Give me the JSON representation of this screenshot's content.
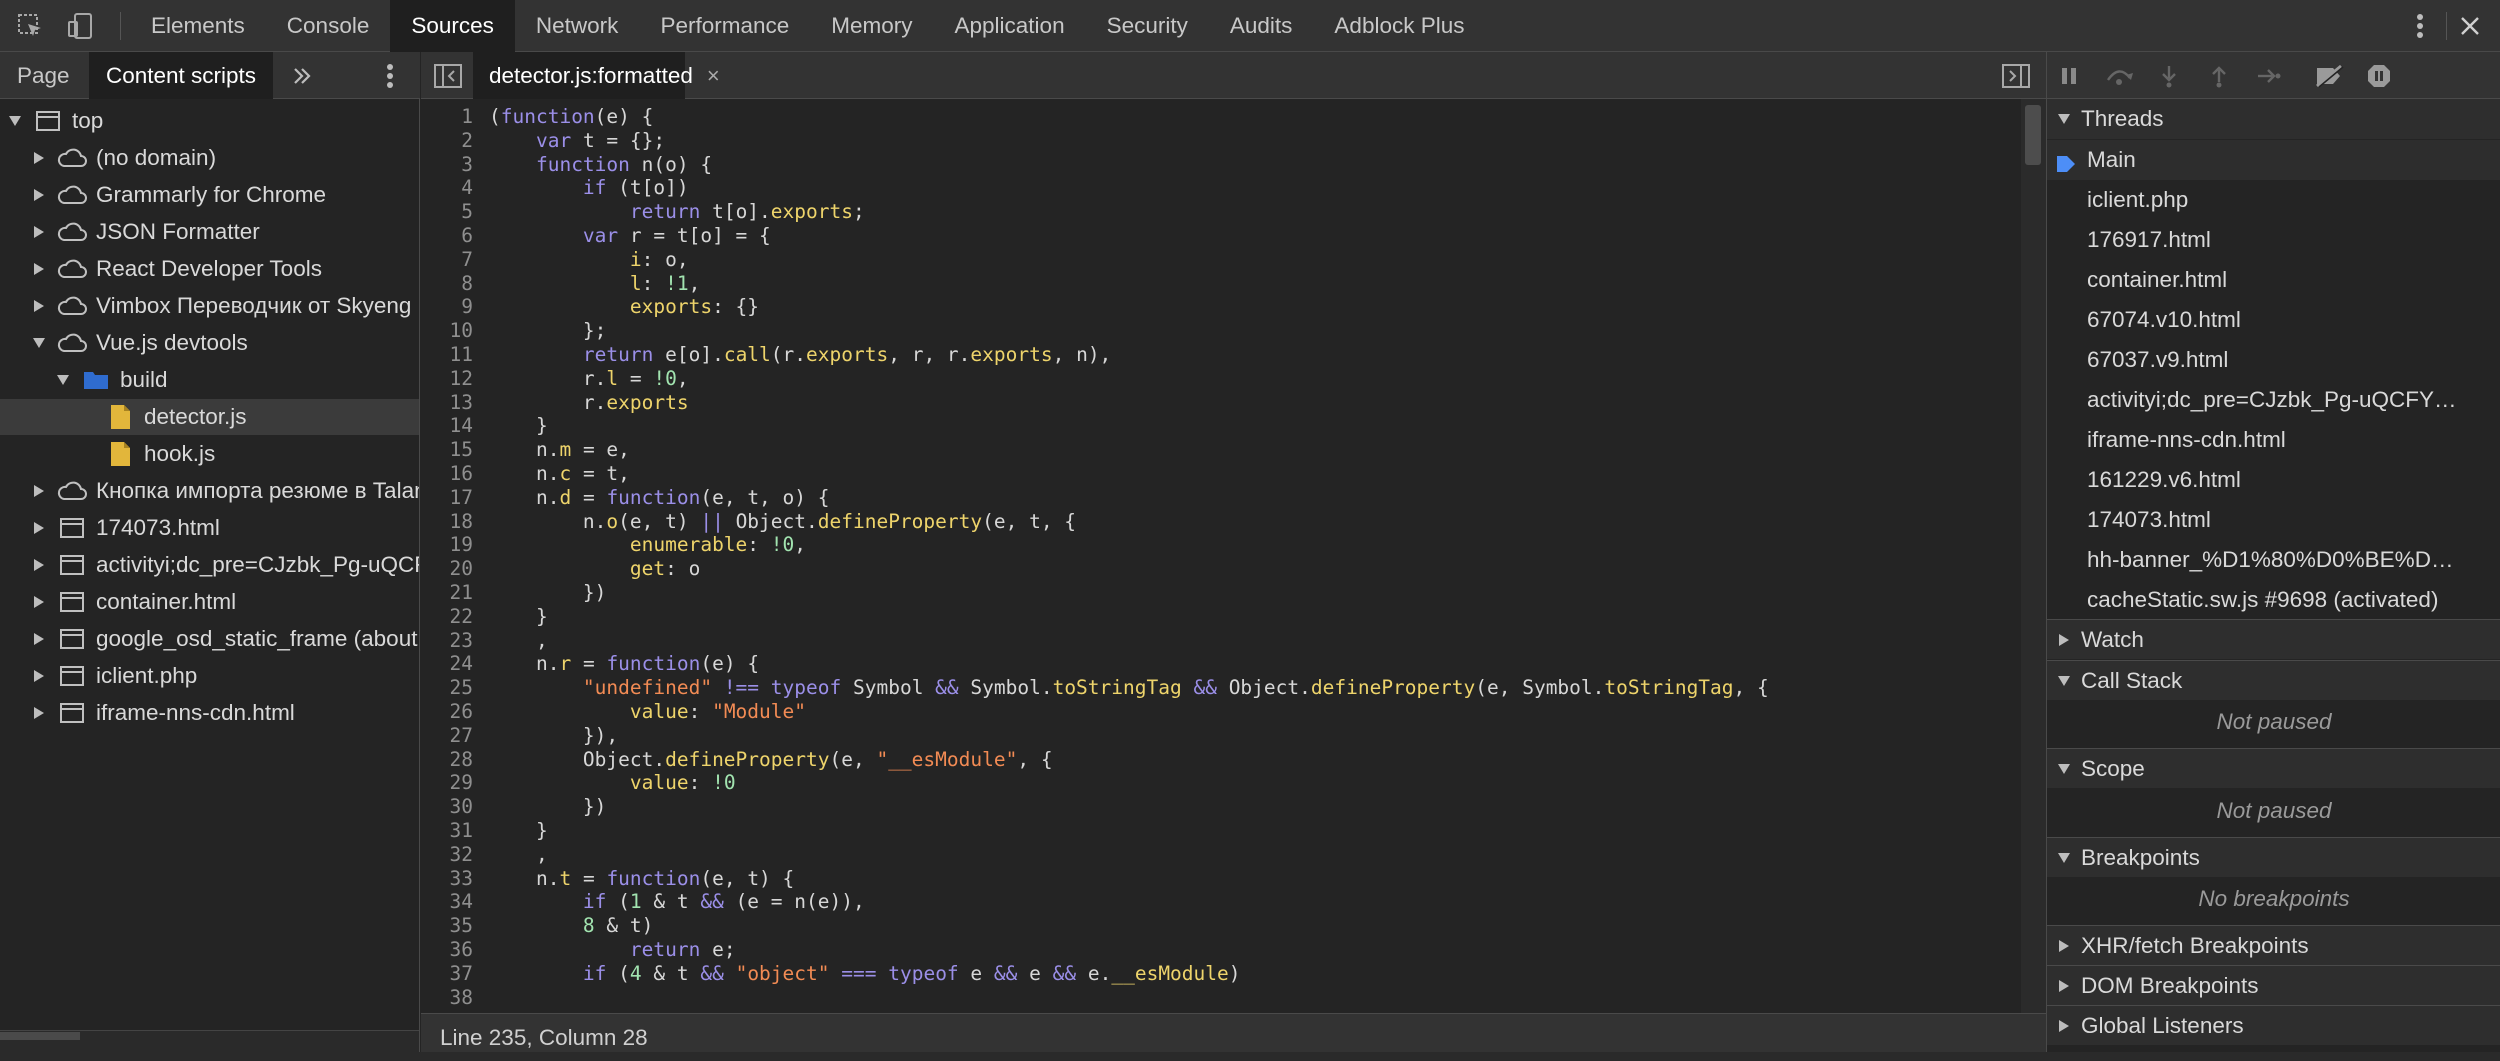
{
  "toolbar": {
    "tabs": [
      "Elements",
      "Console",
      "Sources",
      "Network",
      "Performance",
      "Memory",
      "Application",
      "Security",
      "Audits",
      "Adblock Plus"
    ],
    "active_tab": "Sources"
  },
  "navigator": {
    "tabs": [
      "Page",
      "Content scripts"
    ],
    "active_tab": "Content scripts",
    "tree": [
      {
        "label": "top",
        "kind": "frame",
        "depth": 0,
        "expanded": true
      },
      {
        "label": "(no domain)",
        "kind": "cloud",
        "depth": 1,
        "expanded": false
      },
      {
        "label": "Grammarly for Chrome",
        "kind": "cloud",
        "depth": 1,
        "expanded": false
      },
      {
        "label": "JSON Formatter",
        "kind": "cloud",
        "depth": 1,
        "expanded": false
      },
      {
        "label": "React Developer Tools",
        "kind": "cloud",
        "depth": 1,
        "expanded": false
      },
      {
        "label": "Vimbox Переводчик от Skyeng",
        "kind": "cloud",
        "depth": 1,
        "expanded": false
      },
      {
        "label": "Vue.js devtools",
        "kind": "cloud",
        "depth": 1,
        "expanded": true
      },
      {
        "label": "build",
        "kind": "folder",
        "depth": 2,
        "expanded": true
      },
      {
        "label": "detector.js",
        "kind": "file",
        "depth": 3,
        "selected": true
      },
      {
        "label": "hook.js",
        "kind": "file",
        "depth": 3
      },
      {
        "label": "Кнопка импорта резюме в Talan",
        "kind": "cloud",
        "depth": 1,
        "expanded": false
      },
      {
        "label": "174073.html",
        "kind": "frame",
        "depth": 1,
        "expanded": false
      },
      {
        "label": "activityi;dc_pre=CJzbk_Pg-uQCF",
        "kind": "frame",
        "depth": 1,
        "expanded": false
      },
      {
        "label": "container.html",
        "kind": "frame",
        "depth": 1,
        "expanded": false
      },
      {
        "label": "google_osd_static_frame (about:",
        "kind": "frame",
        "depth": 1,
        "expanded": false
      },
      {
        "label": "iclient.php",
        "kind": "frame",
        "depth": 1,
        "expanded": false
      },
      {
        "label": "iframe-nns-cdn.html",
        "kind": "frame",
        "depth": 1,
        "expanded": false
      }
    ]
  },
  "editor": {
    "tab_label": "detector.js:formatted",
    "tab_close": "×",
    "status": "Line 235, Column 28",
    "lines": [
      "(function(e) {",
      "    var t = {};",
      "    function n(o) {",
      "        if (t[o])",
      "            return t[o].exports;",
      "        var r = t[o] = {",
      "            i: o,",
      "            l: !1,",
      "            exports: {}",
      "        };",
      "        return e[o].call(r.exports, r, r.exports, n),",
      "        r.l = !0,",
      "        r.exports",
      "    }",
      "    n.m = e,",
      "    n.c = t,",
      "    n.d = function(e, t, o) {",
      "        n.o(e, t) || Object.defineProperty(e, t, {",
      "            enumerable: !0,",
      "            get: o",
      "        })",
      "    }",
      "    ,",
      "    n.r = function(e) {",
      "        \"undefined\" !== typeof Symbol && Symbol.toStringTag && Object.defineProperty(e, Symbol.toStringTag, {",
      "            value: \"Module\"",
      "        }),",
      "        Object.defineProperty(e, \"__esModule\", {",
      "            value: !0",
      "        })",
      "    }",
      "    ,",
      "    n.t = function(e, t) {",
      "        if (1 & t && (e = n(e)),",
      "        8 & t)",
      "            return e;",
      "        if (4 & t && \"object\" === typeof e && e && e.__esModule)",
      ""
    ]
  },
  "debugger": {
    "threads_title": "Threads",
    "threads": [
      "Main",
      "iclient.php",
      "176917.html",
      "container.html",
      "67074.v10.html",
      "67037.v9.html",
      "activityi;dc_pre=CJzbk_Pg-uQCFY…",
      "iframe-nns-cdn.html",
      "161229.v6.html",
      "174073.html",
      "hh-banner_%D1%80%D0%BE%D…",
      "cacheStatic.sw.js #9698 (activated)"
    ],
    "watch_title": "Watch",
    "call_stack_title": "Call Stack",
    "call_stack_empty": "Not paused",
    "scope_title": "Scope",
    "scope_empty": "Not paused",
    "breakpoints_title": "Breakpoints",
    "breakpoints_empty": "No breakpoints",
    "xhr_title": "XHR/fetch Breakpoints",
    "dom_title": "DOM Breakpoints",
    "global_title": "Global Listeners"
  },
  "colors": {
    "keyword": "#9b8fe8",
    "property": "#eed46b",
    "string": "#f28b54",
    "number": "#a2e4b0",
    "thread_arrow": "#4d8ef7",
    "folder": "#2f6ccf",
    "file": "#e2b63b"
  }
}
